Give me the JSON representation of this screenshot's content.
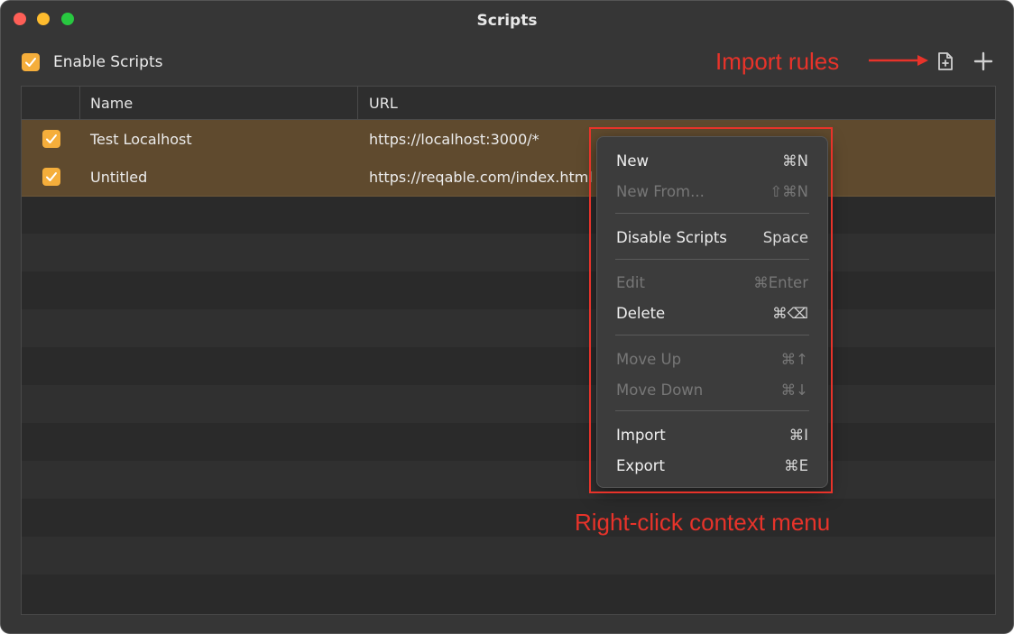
{
  "window": {
    "title": "Scripts"
  },
  "toolbar": {
    "enable_label": "Enable Scripts",
    "enable_checked": true,
    "import_annotation": "Import rules",
    "import_icon": "document-import-icon",
    "add_icon": "plus-icon"
  },
  "table": {
    "columns": [
      "Name",
      "URL"
    ],
    "rows": [
      {
        "enabled": true,
        "name": "Test Localhost",
        "url": "https://localhost:3000/*"
      },
      {
        "enabled": true,
        "name": "Untitled",
        "url": "https://reqable.com/index.html"
      }
    ]
  },
  "context_menu": {
    "annotation": "Right-click context menu",
    "items": [
      {
        "label": "New",
        "shortcut": "⌘N",
        "enabled": true
      },
      {
        "label": "New From...",
        "shortcut": "⇧⌘N",
        "enabled": false
      },
      {
        "label": "Disable Scripts",
        "shortcut": "Space",
        "enabled": true
      },
      {
        "label": "Edit",
        "shortcut": "⌘Enter",
        "enabled": false
      },
      {
        "label": "Delete",
        "shortcut": "⌘⌫",
        "enabled": true
      },
      {
        "label": "Move Up",
        "shortcut": "⌘↑",
        "enabled": false
      },
      {
        "label": "Move Down",
        "shortcut": "⌘↓",
        "enabled": false
      },
      {
        "label": "Import",
        "shortcut": "⌘I",
        "enabled": true
      },
      {
        "label": "Export",
        "shortcut": "⌘E",
        "enabled": true
      }
    ]
  },
  "colors": {
    "accent": "#f5ae3b",
    "annotation": "#e8332a",
    "selected_row": "#5f4a2e"
  }
}
